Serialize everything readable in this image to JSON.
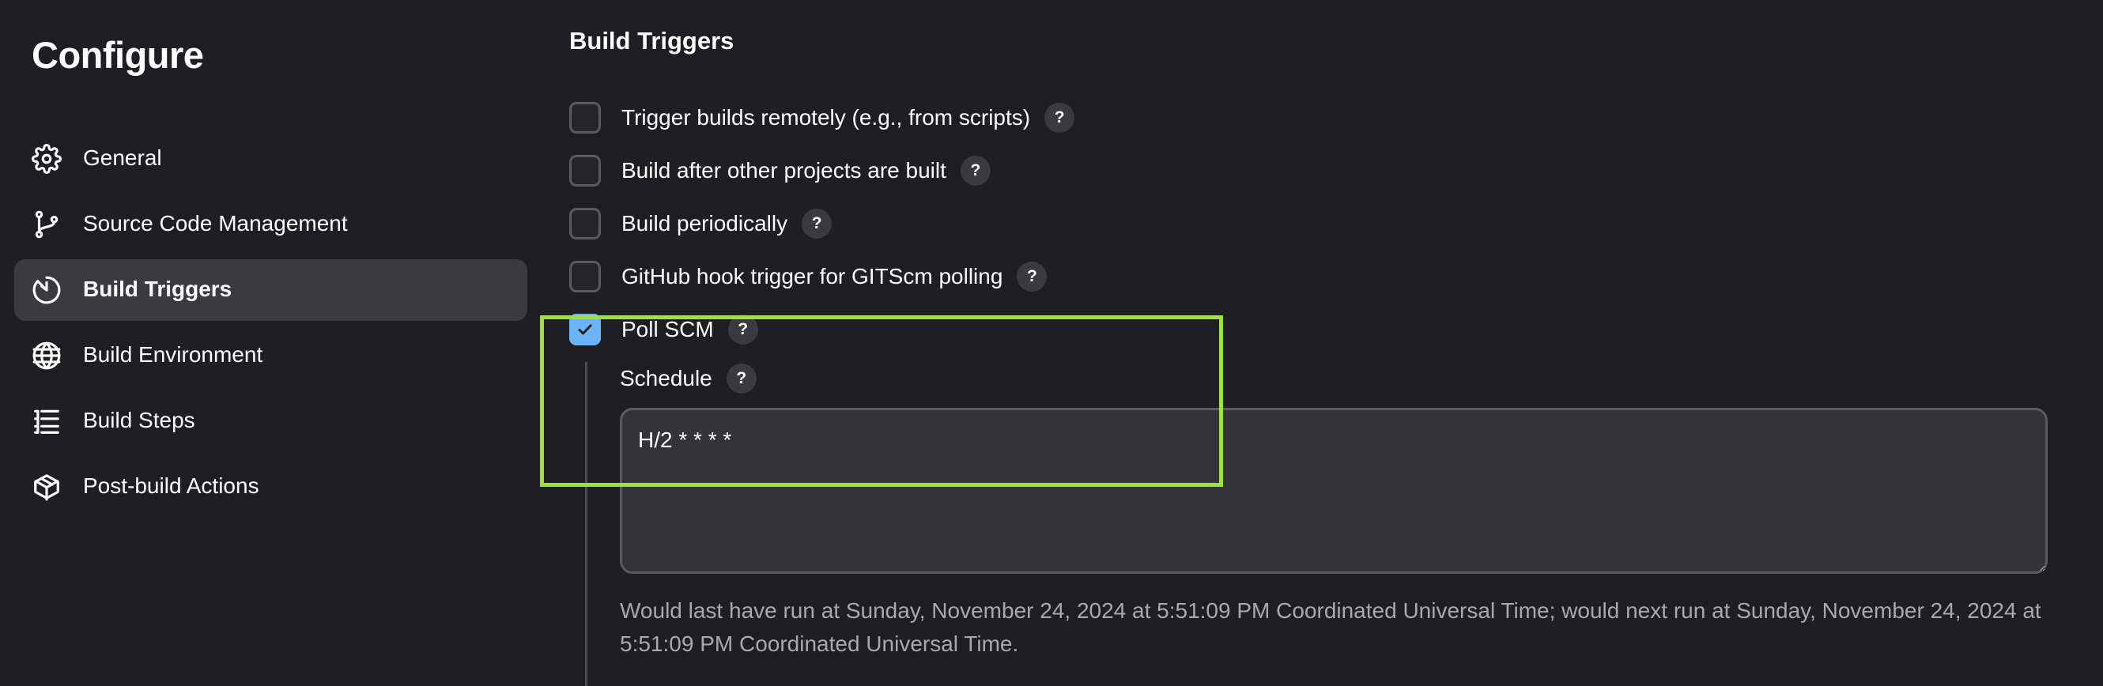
{
  "sidebar": {
    "title": "Configure",
    "items": [
      {
        "label": "General",
        "icon": "gear-icon",
        "active": false
      },
      {
        "label": "Source Code Management",
        "icon": "git-branch-icon",
        "active": false
      },
      {
        "label": "Build Triggers",
        "icon": "timer-icon",
        "active": true
      },
      {
        "label": "Build Environment",
        "icon": "globe-icon",
        "active": false
      },
      {
        "label": "Build Steps",
        "icon": "list-icon",
        "active": false
      },
      {
        "label": "Post-build Actions",
        "icon": "package-icon",
        "active": false
      }
    ]
  },
  "main": {
    "section_title": "Build Triggers",
    "triggers": [
      {
        "label": "Trigger builds remotely (e.g., from scripts)",
        "checked": false,
        "help": "?"
      },
      {
        "label": "Build after other projects are built",
        "checked": false,
        "help": "?"
      },
      {
        "label": "Build periodically",
        "checked": false,
        "help": "?"
      },
      {
        "label": "GitHub hook trigger for GITScm polling",
        "checked": false,
        "help": "?"
      },
      {
        "label": "Poll SCM",
        "checked": true,
        "help": "?"
      }
    ],
    "schedule": {
      "label": "Schedule",
      "help": "?",
      "value": "H/2 * * * *",
      "description": "Would last have run at Sunday, November 24, 2024 at 5:51:09 PM Coordinated Universal Time; would next run at Sunday, November 24, 2024 at 5:51:09 PM Coordinated Universal Time."
    }
  },
  "colors": {
    "background": "#1f1f23",
    "active_nav": "#3a3a3f",
    "checkbox_checked": "#6ab3f5",
    "highlight": "#9fe23f",
    "muted_text": "#a8a8ad"
  }
}
